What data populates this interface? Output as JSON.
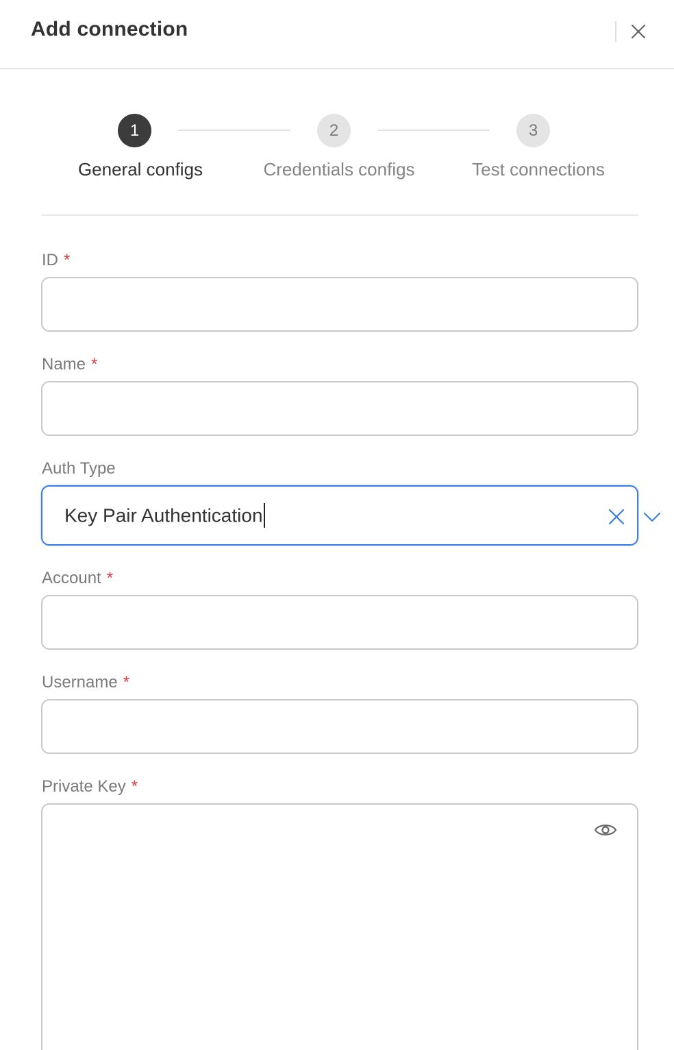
{
  "header": {
    "title": "Add connection",
    "close_icon": "close-icon"
  },
  "stepper": {
    "steps": [
      {
        "number": "1",
        "label": "General configs",
        "state": "active"
      },
      {
        "number": "2",
        "label": "Credentials configs",
        "state": "inactive"
      },
      {
        "number": "3",
        "label": "Test connections",
        "state": "inactive"
      }
    ]
  },
  "form": {
    "id": {
      "label": "ID",
      "required_mark": "*",
      "value": ""
    },
    "name": {
      "label": "Name",
      "required_mark": "*",
      "value": ""
    },
    "auth_type": {
      "label": "Auth Type",
      "value": "Key Pair Authentication",
      "clear_icon": "clear-icon",
      "dropdown_icon": "chevron-down-icon"
    },
    "account": {
      "label": "Account",
      "required_mark": "*",
      "value": ""
    },
    "username": {
      "label": "Username",
      "required_mark": "*",
      "value": ""
    },
    "private_key": {
      "label": "Private Key",
      "required_mark": "*",
      "value": "",
      "visibility_icon": "eye-icon"
    }
  },
  "colors": {
    "required": "#e0393e",
    "focus_border": "#3a7ee6",
    "active_step": "#3c3c3c"
  }
}
